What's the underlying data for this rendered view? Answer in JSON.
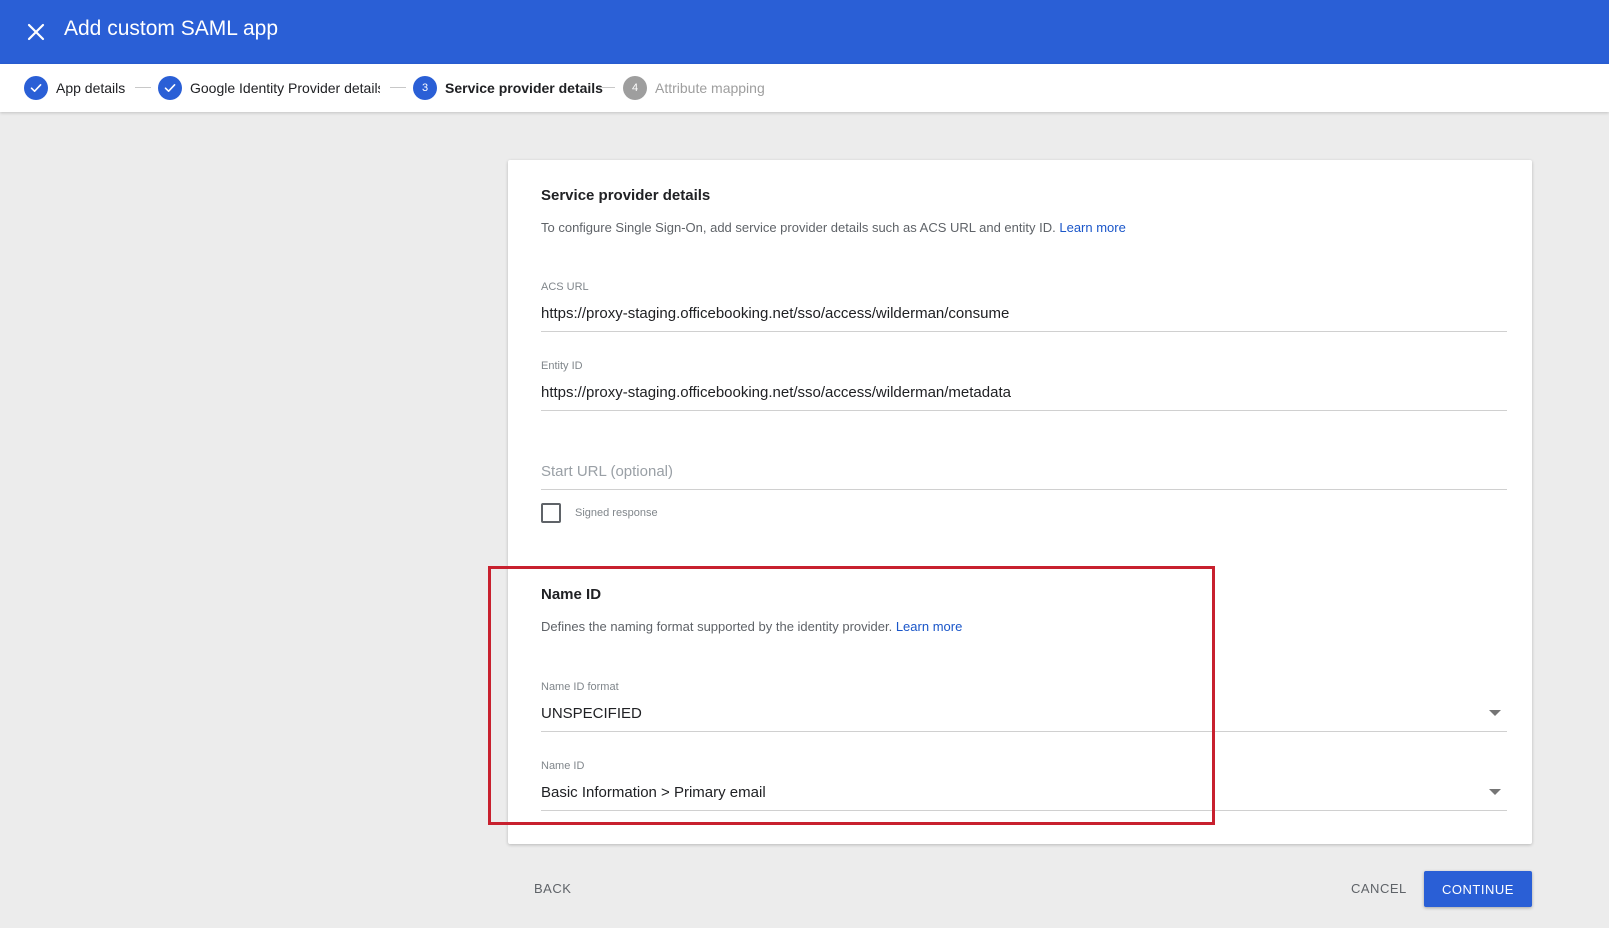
{
  "header": {
    "title": "Add custom SAML app",
    "close_icon": "close-icon",
    "bg_color": "#2a5fd6"
  },
  "stepper": {
    "steps": [
      {
        "number": "",
        "label": "App details",
        "state": "done",
        "icon": "check-icon"
      },
      {
        "number": "",
        "label": "Google Identity Provider details",
        "state": "done",
        "icon": "check-icon"
      },
      {
        "number": "3",
        "label": "Service provider details",
        "state": "active"
      },
      {
        "number": "4",
        "label": "Attribute mapping",
        "state": "pending"
      }
    ]
  },
  "service_provider": {
    "title": "Service provider details",
    "description": "To configure Single Sign-On, add service provider details such as ACS URL and entity ID.",
    "learn_more": "Learn more",
    "acs_url": {
      "label": "ACS URL",
      "value": "https://proxy-staging.officebooking.net/sso/access/wilderman/consume"
    },
    "entity_id": {
      "label": "Entity ID",
      "value": "https://proxy-staging.officebooking.net/sso/access/wilderman/metadata"
    },
    "start_url": {
      "placeholder": "Start URL (optional)",
      "value": ""
    },
    "signed_response": {
      "label": "Signed response",
      "checked": false
    }
  },
  "name_id": {
    "title": "Name ID",
    "description": "Defines the naming format supported by the identity provider.",
    "learn_more": "Learn more",
    "format": {
      "label": "Name ID format",
      "value": "UNSPECIFIED"
    },
    "name_id": {
      "label": "Name ID",
      "value": "Basic Information > Primary email"
    }
  },
  "footer": {
    "back": "BACK",
    "cancel": "CANCEL",
    "continue": "CONTINUE"
  },
  "highlight_color": "#c8202e"
}
